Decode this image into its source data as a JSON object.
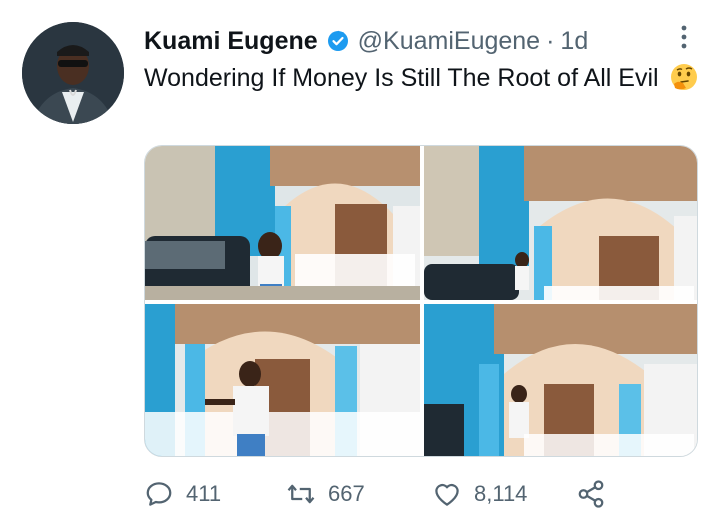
{
  "tweet": {
    "author_name": "Kuami Eugene",
    "handle": "@KuamiEugene",
    "separator": "·",
    "time": "1d",
    "text": "Wondering If Money Is Still The Root of All Evil",
    "emoji": "🤔",
    "verified": true,
    "accent_color": "#1d9bf0"
  },
  "actions": {
    "replies": "411",
    "retweets": "667",
    "likes": "8,114"
  },
  "icons": {
    "reply": "reply-icon",
    "retweet": "retweet-icon",
    "like": "heart-icon",
    "share": "share-icon",
    "more": "more-icon",
    "verified": "verified-badge-icon"
  }
}
